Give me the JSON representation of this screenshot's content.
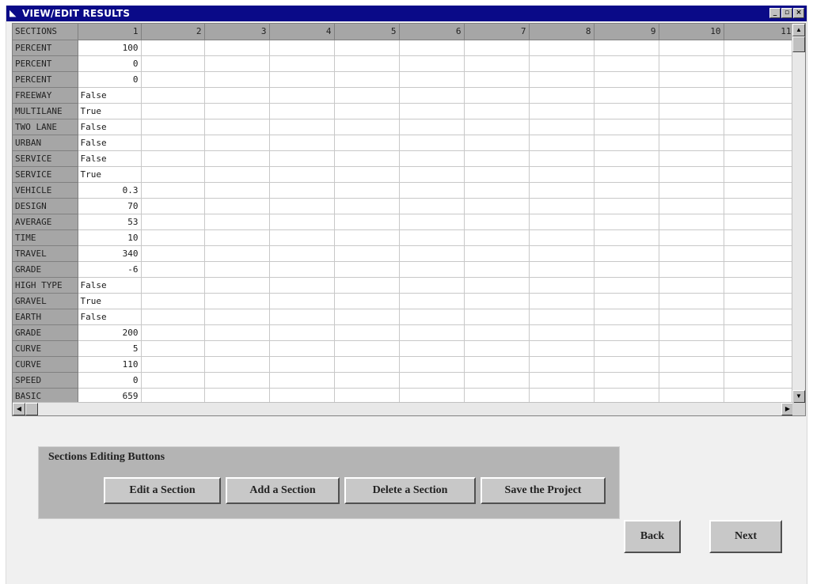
{
  "window": {
    "title": "VIEW/EDIT RESULTS",
    "controls": {
      "minimize": "_",
      "maximize": "▫",
      "close": "×"
    }
  },
  "grid": {
    "corner_label": "SECTIONS",
    "columns": [
      "1",
      "2",
      "3",
      "4",
      "5",
      "6",
      "7",
      "8",
      "9",
      "10",
      "11"
    ],
    "rows": [
      {
        "label": "PERCENT",
        "value": "100",
        "align": "num"
      },
      {
        "label": "PERCENT",
        "value": "0",
        "align": "num"
      },
      {
        "label": "PERCENT",
        "value": "0",
        "align": "num"
      },
      {
        "label": "FREEWAY",
        "value": "False",
        "align": "txt"
      },
      {
        "label": "MULTILANE",
        "value": "True",
        "align": "txt"
      },
      {
        "label": "TWO LANE",
        "value": "False",
        "align": "txt"
      },
      {
        "label": "URBAN",
        "value": "False",
        "align": "txt"
      },
      {
        "label": "SERVICE",
        "value": "False",
        "align": "txt"
      },
      {
        "label": "SERVICE",
        "value": "True",
        "align": "txt"
      },
      {
        "label": "VEHICLE",
        "value": "0.3",
        "align": "num"
      },
      {
        "label": "DESIGN",
        "value": "70",
        "align": "num"
      },
      {
        "label": "AVERAGE",
        "value": "53",
        "align": "num"
      },
      {
        "label": "TIME",
        "value": "10",
        "align": "num"
      },
      {
        "label": "TRAVEL",
        "value": "340",
        "align": "num"
      },
      {
        "label": "GRADE",
        "value": "-6",
        "align": "num"
      },
      {
        "label": "HIGH TYPE",
        "value": "False",
        "align": "txt"
      },
      {
        "label": "GRAVEL",
        "value": "True",
        "align": "txt"
      },
      {
        "label": "EARTH",
        "value": "False",
        "align": "txt"
      },
      {
        "label": "GRADE",
        "value": "200",
        "align": "num"
      },
      {
        "label": "CURVE",
        "value": "5",
        "align": "num"
      },
      {
        "label": "CURVE",
        "value": "110",
        "align": "num"
      },
      {
        "label": "SPEED",
        "value": "0",
        "align": "num"
      },
      {
        "label": "BASIC",
        "value": "659",
        "align": "num"
      }
    ]
  },
  "editing_panel": {
    "legend": "Sections Editing Buttons",
    "buttons": [
      "Edit a Section",
      "Add a Section",
      "Delete a Section",
      "Save the Project"
    ]
  },
  "nav": {
    "back": "Back",
    "next": "Next"
  },
  "icons": {
    "window": "app-icon",
    "scroll_up": "arrow-up-icon",
    "scroll_down": "arrow-down-icon",
    "scroll_left": "arrow-left-icon",
    "scroll_right": "arrow-right-icon"
  },
  "colors": {
    "titlebar": "#0a0a88",
    "row_header": "#a6a6a6",
    "panel": "#b4b4b4",
    "window_bg": "#f0f0f0"
  }
}
